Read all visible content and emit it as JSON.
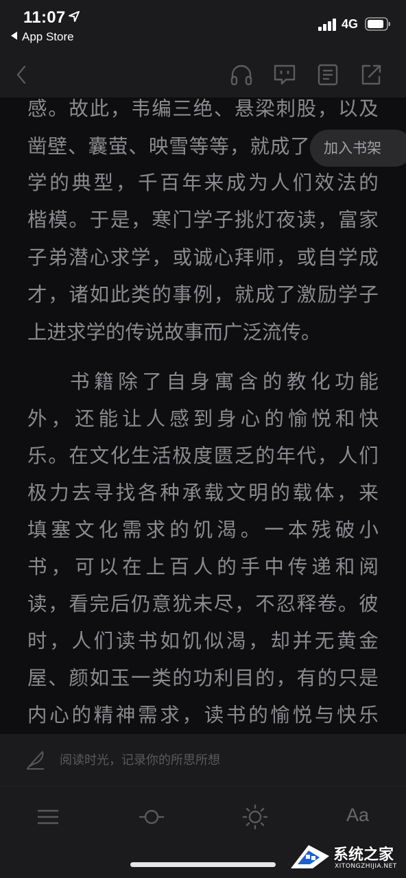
{
  "status_bar": {
    "time": "11:07",
    "back_app": "App Store",
    "network": "4G"
  },
  "nav": {
    "icons": [
      "back-chevron-icon",
      "headphones-icon",
      "comment-icon",
      "contents-icon",
      "share-icon"
    ]
  },
  "content": {
    "lines": [
      "感。故此，韦编三绝、悬梁刺股，以及",
      "凿壁、囊萤、映雪等等，就成了",
      "学的典型，千百年来成为人们效法的",
      "楷模。于是，寒门学子挑灯夜读，富家",
      "子弟潜心求学，或诚心拜师，或自学成",
      "才，诸如此类的事例，就成了激励学子",
      "上进求学的传说故事而广泛流传。",
      "书籍除了自身寓含的教化功能",
      "外，还能让人感到身心的愉悦和快",
      "乐。在文化生活极度匮乏的年代，人们",
      "极力去寻找各种承载文明的载体，来",
      "填塞文化需求的饥渴。一本残破小",
      "书，可以在上百人的手中传递和阅",
      "读，看完后仍意犹未尽，不忍释卷。彼",
      "时，人们读书如饥似渴，却并无黄金",
      "屋、颜如玉一类的功利目的，有的只是",
      "内心的精神需求，读书的愉悦与快乐"
    ],
    "add_to_shelf": "加入书架"
  },
  "note_bar": {
    "placeholder": "阅读时光，记录你的所思所想"
  },
  "toolbar": {
    "font_label": "Aa",
    "icons": [
      "menu-icon",
      "progress-slider-icon",
      "brightness-icon",
      "font-icon"
    ]
  },
  "watermark": {
    "title": "系统之家",
    "url": "XITONGZHIJIA.NET"
  },
  "colors": {
    "background": "#0e0e10",
    "bar": "#1b1b1d",
    "text": "#8b8b8f"
  }
}
